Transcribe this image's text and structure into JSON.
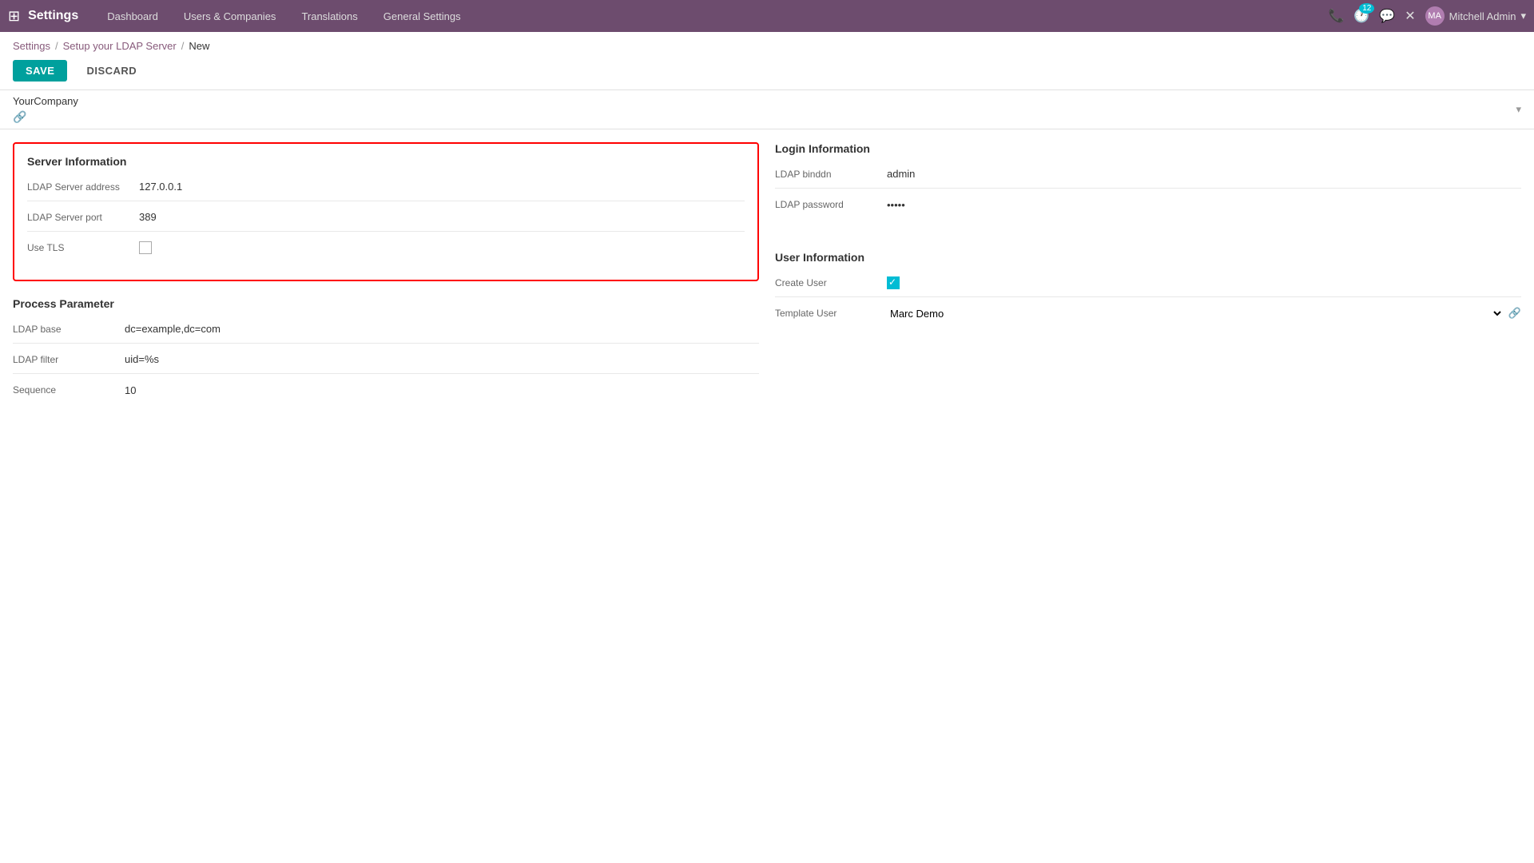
{
  "navbar": {
    "grid_icon": "⊞",
    "title": "Settings",
    "menu": [
      {
        "label": "Dashboard",
        "id": "dashboard"
      },
      {
        "label": "Users & Companies",
        "id": "users-companies"
      },
      {
        "label": "Translations",
        "id": "translations"
      },
      {
        "label": "General Settings",
        "id": "general-settings"
      }
    ],
    "right": {
      "phone_icon": "📞",
      "clock_icon": "🕐",
      "badge_count": "12",
      "chat_icon": "💬",
      "close_icon": "✕",
      "user": {
        "name": "Mitchell Admin",
        "avatar_initials": "MA"
      }
    }
  },
  "breadcrumb": {
    "settings_label": "Settings",
    "setup_label": "Setup your LDAP Server",
    "current": "New"
  },
  "actions": {
    "save_label": "SAVE",
    "discard_label": "DISCARD"
  },
  "company": {
    "value": "YourCompany",
    "link_icon": "🔗"
  },
  "server_info": {
    "title": "Server Information",
    "fields": [
      {
        "label": "LDAP Server address",
        "value": "127.0.0.1"
      },
      {
        "label": "LDAP Server port",
        "value": "389"
      },
      {
        "label": "Use TLS",
        "value": "",
        "type": "checkbox",
        "checked": false
      }
    ]
  },
  "process_parameter": {
    "title": "Process Parameter",
    "fields": [
      {
        "label": "LDAP base",
        "value": "dc=example,dc=com"
      },
      {
        "label": "LDAP filter",
        "value": "uid=%s"
      },
      {
        "label": "Sequence",
        "value": "10"
      }
    ]
  },
  "login_info": {
    "title": "Login Information",
    "fields": [
      {
        "label": "LDAP binddn",
        "value": "admin"
      },
      {
        "label": "LDAP password",
        "value": "admin"
      }
    ]
  },
  "user_info": {
    "title": "User Information",
    "fields": [
      {
        "label": "Create User",
        "type": "checkbox",
        "checked": true
      },
      {
        "label": "Template User",
        "value": "Marc Demo"
      }
    ]
  }
}
